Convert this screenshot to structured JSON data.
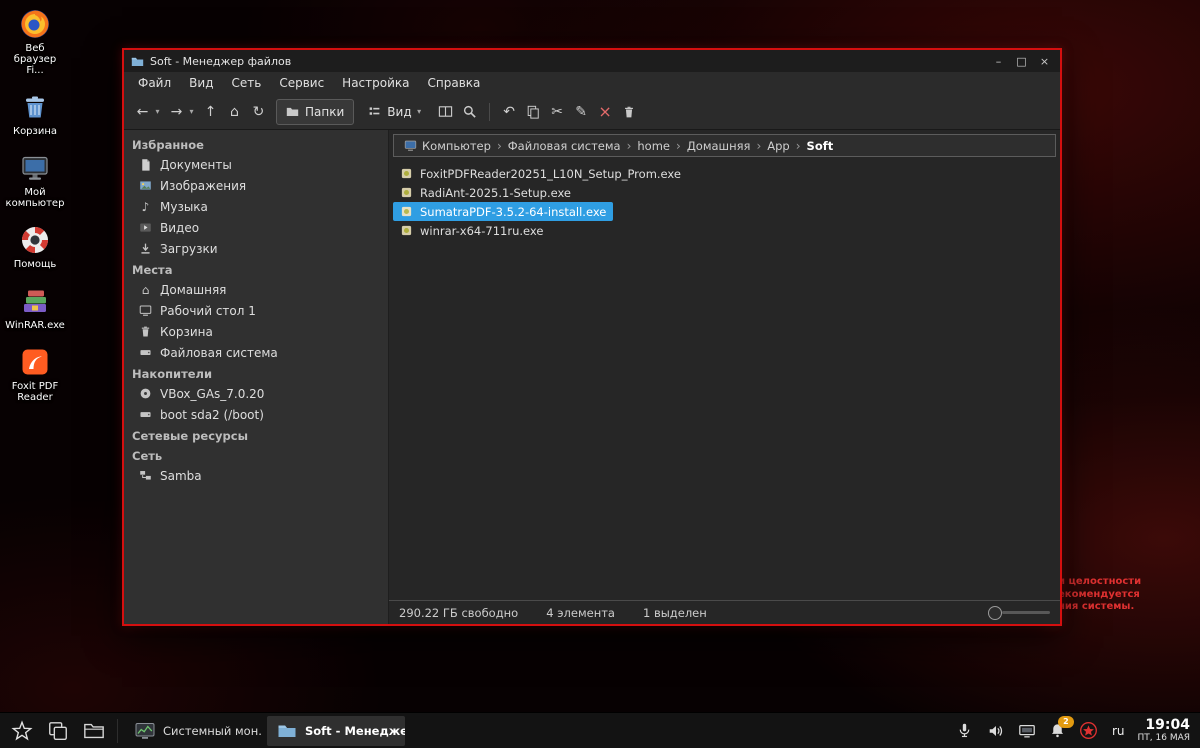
{
  "desktop": {
    "icons": [
      {
        "name": "firefox",
        "label": "Веб браузер Fi..."
      },
      {
        "name": "trash",
        "label": "Корзина"
      },
      {
        "name": "my-computer",
        "label": "Мой компьютер"
      },
      {
        "name": "help",
        "label": "Помощь"
      },
      {
        "name": "winrar",
        "label": "WinRAR.exe"
      },
      {
        "name": "foxit",
        "label": "Foxit PDF Reader"
      }
    ],
    "warning": {
      "lines": [
        "и целостности",
        "екомендуется",
        "ния системы."
      ]
    }
  },
  "icons": {
    "back": "←",
    "forward": "→",
    "up": "↑",
    "home": "⌂",
    "reload": "↻",
    "dropdown": "▾",
    "undo": "↶",
    "cut": "✂",
    "edit": "✎",
    "delete": "×",
    "music": "♪",
    "minimize": "–",
    "maximize": "□",
    "close": "×",
    "crumb_sep": "›"
  },
  "window": {
    "title": "Soft - Менеджер файлов",
    "menu": [
      "Файл",
      "Вид",
      "Сеть",
      "Сервис",
      "Настройка",
      "Справка"
    ],
    "toolbar": {
      "folders_label": "Папки",
      "view_label": "Вид"
    },
    "sidebar": {
      "sections": [
        {
          "title": "Избранное",
          "items": [
            {
              "label": "Документы"
            },
            {
              "label": "Изображения"
            },
            {
              "label": "Музыка"
            },
            {
              "label": "Видео"
            },
            {
              "label": "Загрузки"
            }
          ]
        },
        {
          "title": "Места",
          "items": [
            {
              "label": "Домашняя"
            },
            {
              "label": "Рабочий стол 1"
            },
            {
              "label": "Корзина"
            },
            {
              "label": "Файловая система"
            }
          ]
        },
        {
          "title": "Накопители",
          "items": [
            {
              "label": "VBox_GAs_7.0.20"
            },
            {
              "label": "boot sda2 (/boot)"
            }
          ]
        },
        {
          "title": "Сетевые ресурсы",
          "items": []
        },
        {
          "title": "Сеть",
          "items": [
            {
              "label": "Samba"
            }
          ]
        }
      ]
    },
    "path": {
      "crumbs": [
        "Компьютер",
        "Файловая система",
        "home",
        "Домашняя",
        "App",
        "Soft"
      ]
    },
    "files": [
      {
        "name": "FoxitPDFReader20251_L10N_Setup_Prom.exe",
        "selected": false
      },
      {
        "name": "RadiAnt-2025.1-Setup.exe",
        "selected": false
      },
      {
        "name": "SumatraPDF-3.5.2-64-install.exe",
        "selected": true
      },
      {
        "name": "winrar-x64-711ru.exe",
        "selected": false
      }
    ],
    "status": {
      "free": "290.22 ГБ свободно",
      "count": "4 элемента",
      "selected": "1 выделен"
    }
  },
  "taskbar": {
    "tasks": [
      {
        "label": "Системный мон...",
        "active": false
      },
      {
        "label": "Soft - Менедже...",
        "active": true
      }
    ],
    "tray": {
      "notifications_badge": "2",
      "keyboard_layout": "ru",
      "time": "19:04",
      "date": "ПТ, 16 МАЯ"
    }
  }
}
